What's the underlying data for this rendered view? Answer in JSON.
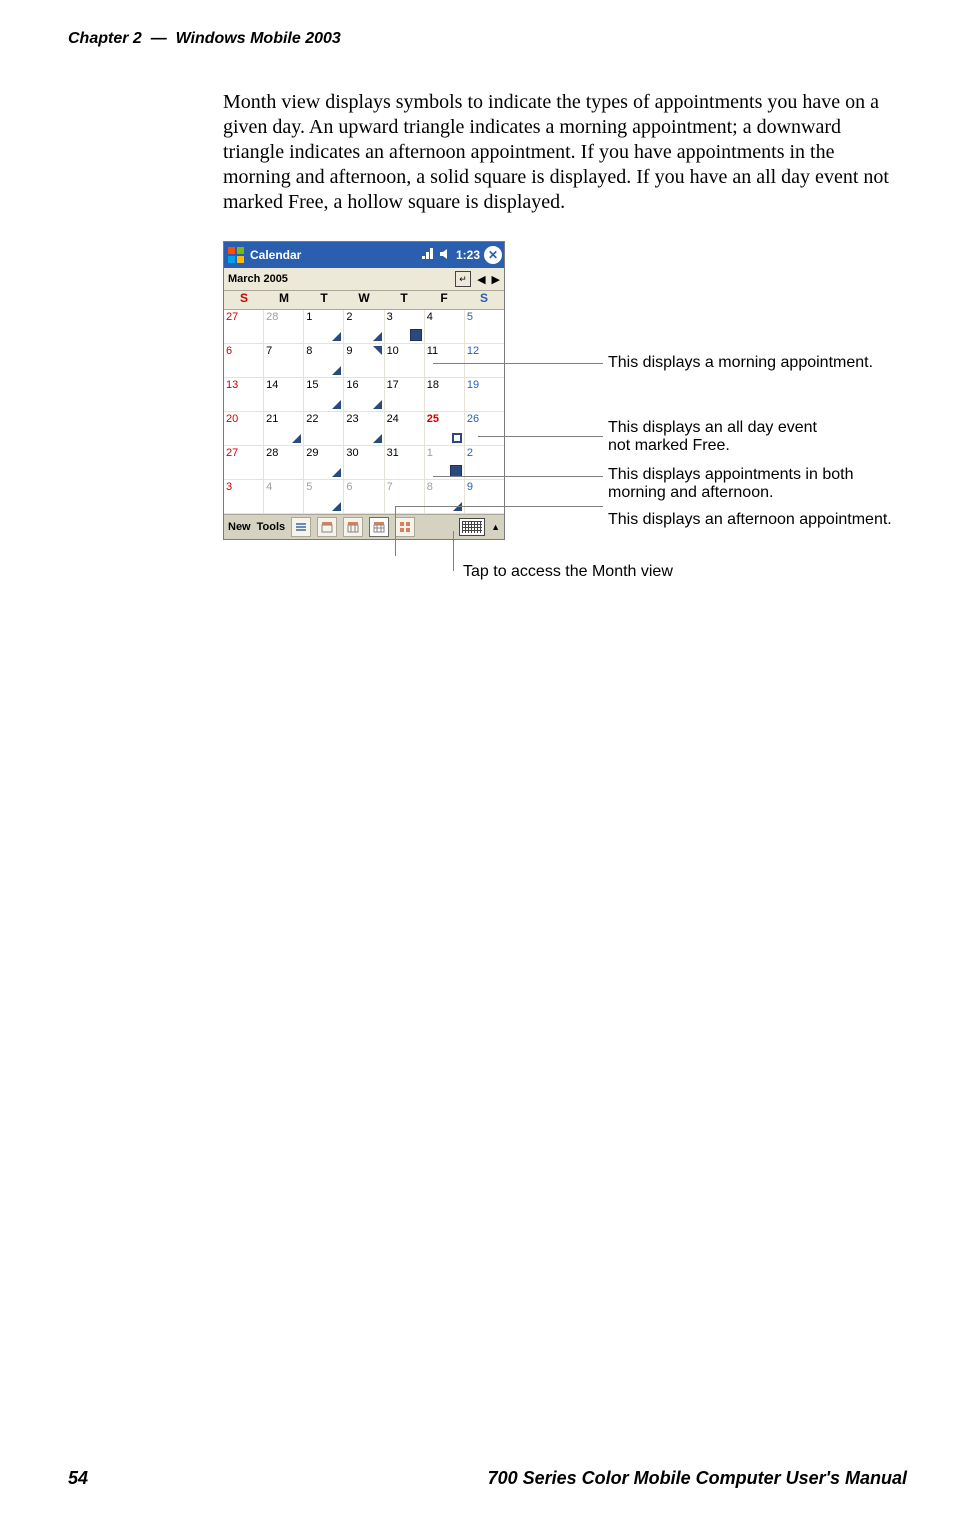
{
  "header": {
    "chapter": "Chapter 2",
    "sep": "—",
    "title": "Windows Mobile 2003"
  },
  "paragraph": "Month view displays symbols to indicate the types of appointments you have on a given day. An upward triangle indicates a morning appointment; a downward triangle indicates an afternoon appointment. If you have appointments in the morning and afternoon, a solid square is displayed. If you have an all day event not marked Free, a hollow square is displayed.",
  "screenshot": {
    "title": "Calendar",
    "time": "1:23",
    "month": "March 2005",
    "dow": [
      "S",
      "M",
      "T",
      "W",
      "T",
      "F",
      "S"
    ],
    "weeks": [
      [
        {
          "n": "27",
          "cls": "sun out"
        },
        {
          "n": "28",
          "cls": "out"
        },
        {
          "n": "1",
          "mark": "dn"
        },
        {
          "n": "2",
          "mark": "dn"
        },
        {
          "n": "3",
          "mark": "sq"
        },
        {
          "n": "4"
        },
        {
          "n": "5",
          "cls": "sat"
        }
      ],
      [
        {
          "n": "6",
          "cls": "sun"
        },
        {
          "n": "7"
        },
        {
          "n": "8",
          "mark": "dn"
        },
        {
          "n": "9",
          "mark": "up"
        },
        {
          "n": "10"
        },
        {
          "n": "11"
        },
        {
          "n": "12",
          "cls": "sat"
        }
      ],
      [
        {
          "n": "13",
          "cls": "sun"
        },
        {
          "n": "14"
        },
        {
          "n": "15",
          "mark": "dn"
        },
        {
          "n": "16",
          "mark": "dn"
        },
        {
          "n": "17"
        },
        {
          "n": "18"
        },
        {
          "n": "19",
          "cls": "sat"
        }
      ],
      [
        {
          "n": "20",
          "cls": "sun"
        },
        {
          "n": "21",
          "mark": "dn"
        },
        {
          "n": "22"
        },
        {
          "n": "23",
          "mark": "dn"
        },
        {
          "n": "24"
        },
        {
          "n": "25",
          "cls": "today",
          "mark": "hsq"
        },
        {
          "n": "26",
          "cls": "sat"
        }
      ],
      [
        {
          "n": "27",
          "cls": "sun"
        },
        {
          "n": "28"
        },
        {
          "n": "29",
          "mark": "dn"
        },
        {
          "n": "30"
        },
        {
          "n": "31"
        },
        {
          "n": "1",
          "cls": "out",
          "mark": "sq"
        },
        {
          "n": "2",
          "cls": "sat out"
        }
      ],
      [
        {
          "n": "3",
          "cls": "sun out"
        },
        {
          "n": "4",
          "cls": "out"
        },
        {
          "n": "5",
          "cls": "out",
          "mark": "dn"
        },
        {
          "n": "6",
          "cls": "out"
        },
        {
          "n": "7",
          "cls": "out"
        },
        {
          "n": "8",
          "cls": "out",
          "mark": "dn"
        },
        {
          "n": "9",
          "cls": "sat out"
        }
      ]
    ],
    "menu": {
      "new": "New",
      "tools": "Tools"
    }
  },
  "callouts": {
    "morning": "This displays a morning appointment.",
    "allday": "This displays an all day event\nnot marked Free.",
    "both": "This displays appointments in both\nmorning and afternoon.",
    "afternoon": "This displays an afternoon appointment.",
    "monthview": "Tap to access the Month view"
  },
  "footer": {
    "page": "54",
    "title": "700 Series Color Mobile Computer User's Manual"
  }
}
